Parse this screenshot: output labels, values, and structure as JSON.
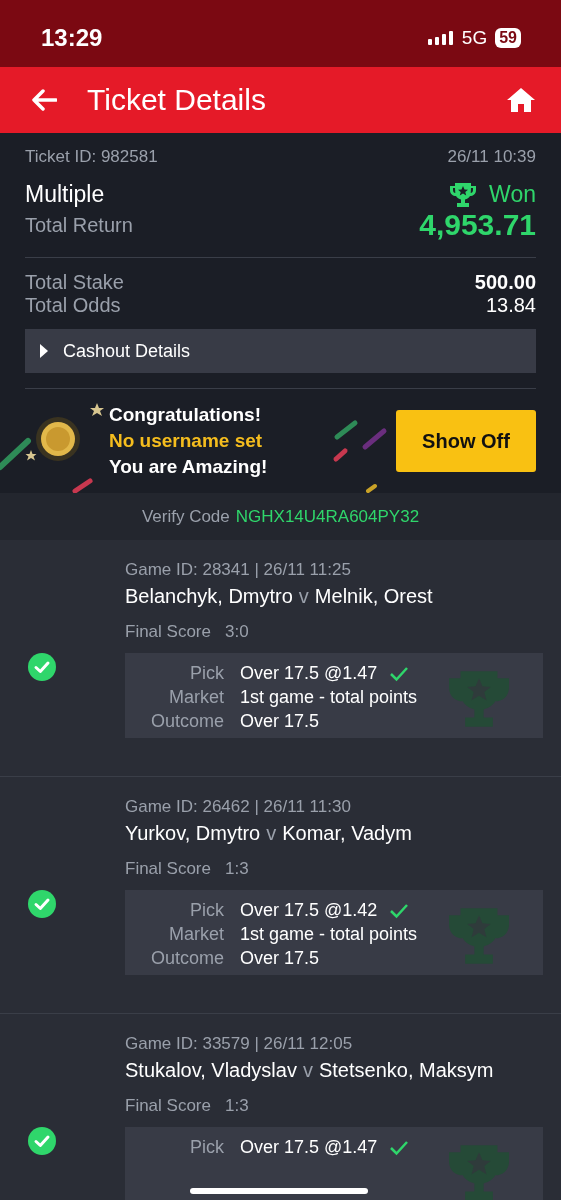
{
  "status_bar": {
    "time": "13:29",
    "network": "5G",
    "battery": "59"
  },
  "header": {
    "title": "Ticket Details"
  },
  "ticket": {
    "id": "Ticket ID: 982581",
    "date": "26/11 10:39",
    "type": "Multiple",
    "won": true,
    "status_label": "Won",
    "return_label": "Total Return",
    "return_value": "4,953.71",
    "stake_label": "Total Stake",
    "stake_value": "500.00",
    "odds_label": "Total Odds",
    "odds_value": "13.84",
    "cashout": {
      "label": "Cashout Details",
      "expanded": false
    }
  },
  "promo": {
    "title": "Congratulations!",
    "username": "No username set",
    "message": "You are Amazing!",
    "button": "Show Off"
  },
  "verify": {
    "label": "Verify Code",
    "code": "NGHX14U4RA604PY32"
  },
  "games": [
    {
      "won": true,
      "meta": "Game ID: 28341 | 26/11 11:25",
      "home": "Belanchyk, Dmytro",
      "vs": "v",
      "away": "Melnik, Orest",
      "score_label": "Final Score",
      "score": "3:0",
      "details": [
        {
          "label": "Pick",
          "value": "Over 17.5 @1.47",
          "won": true
        },
        {
          "label": "Market",
          "value": "1st game - total points",
          "won": false
        },
        {
          "label": "Outcome",
          "value": "Over 17.5",
          "won": false
        }
      ]
    },
    {
      "won": true,
      "meta": "Game ID: 26462 | 26/11 11:30",
      "home": "Yurkov, Dmytro",
      "vs": "v",
      "away": "Komar, Vadym",
      "score_label": "Final Score",
      "score": "1:3",
      "details": [
        {
          "label": "Pick",
          "value": "Over 17.5 @1.42",
          "won": true
        },
        {
          "label": "Market",
          "value": "1st game - total points",
          "won": false
        },
        {
          "label": "Outcome",
          "value": "Over 17.5",
          "won": false
        }
      ]
    },
    {
      "won": true,
      "meta": "Game ID: 33579 | 26/11 12:05",
      "home": "Stukalov, Vladyslav",
      "vs": "v",
      "away": "Stetsenko, Maksym",
      "score_label": "Final Score",
      "score": "1:3",
      "details": [
        {
          "label": "Pick",
          "value": "Over 17.5 @1.47",
          "won": true
        }
      ]
    }
  ]
}
